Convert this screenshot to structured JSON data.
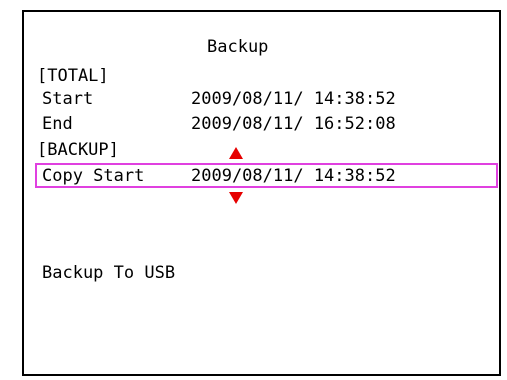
{
  "title": "Backup",
  "total_section": {
    "header": "[TOTAL]",
    "start_label": "Start",
    "start_value": "2009/08/11/ 14:38:52",
    "end_label": "End",
    "end_value": "2009/08/11/ 16:52:08"
  },
  "backup_section": {
    "header": "[BACKUP]",
    "copy_start_label": "Copy Start",
    "copy_start_value": "2009/08/11/ 14:38:52"
  },
  "backup_target": "Backup To USB",
  "icons": {
    "increase": "arrow-up-icon",
    "decrease": "arrow-down-icon"
  },
  "colors": {
    "selection": "#e040e0",
    "arrows": "#e60000"
  }
}
